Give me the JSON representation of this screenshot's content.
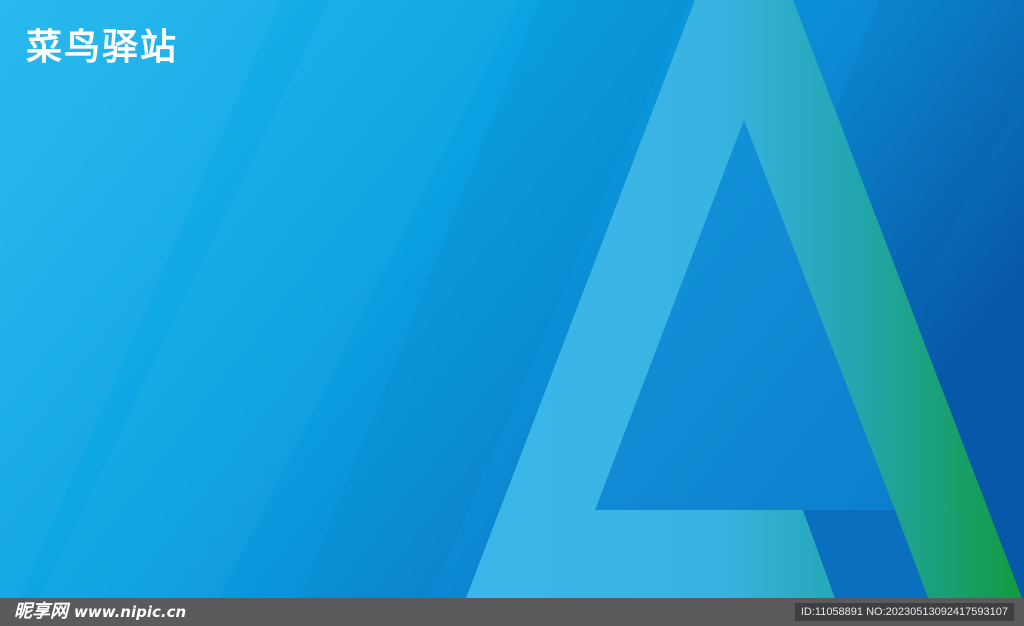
{
  "brand": {
    "title": "菜鸟驿站"
  },
  "footer": {
    "logo_text": "昵享网",
    "site": "www.nipic.cn",
    "id_text": "ID:11058891 NO:20230513092417593107"
  },
  "colors": {
    "background_light": "#1fb8ee",
    "background_dark": "#0a5fb0",
    "letter_a_left": "#3db4e8",
    "letter_a_right": "#1a9a48",
    "footer_bar": "#5a5a5c",
    "title": "#ffffff"
  }
}
